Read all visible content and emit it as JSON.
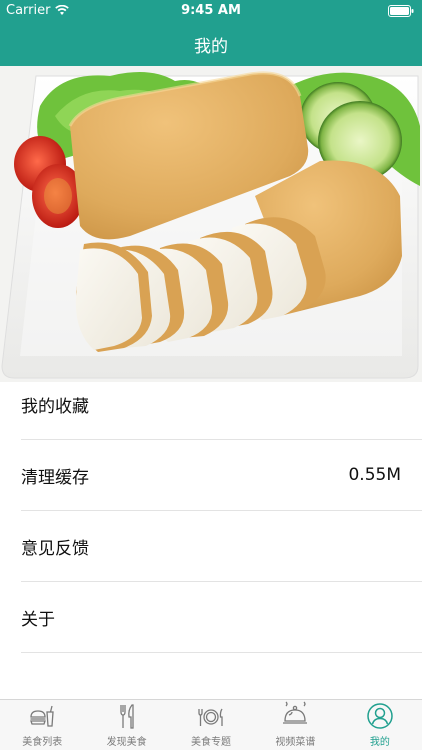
{
  "status": {
    "carrier": "Carrier",
    "time": "9:45 AM"
  },
  "nav": {
    "title": "我的"
  },
  "hero": {
    "image": "fish-cake-on-plate"
  },
  "settings": {
    "items": [
      {
        "label": "我的收藏",
        "value": ""
      },
      {
        "label": "清理缓存",
        "value": "0.55M"
      },
      {
        "label": "意见反馈",
        "value": ""
      },
      {
        "label": "关于",
        "value": ""
      }
    ]
  },
  "tabbar": {
    "tabs": [
      {
        "label": "美食列表",
        "icon": "burger-drink-icon"
      },
      {
        "label": "发现美食",
        "icon": "fork-knife-icon"
      },
      {
        "label": "美食专题",
        "icon": "plate-cutlery-icon"
      },
      {
        "label": "视频菜谱",
        "icon": "cloche-icon"
      },
      {
        "label": "我的",
        "icon": "user-circle-icon",
        "active": true
      }
    ]
  },
  "colors": {
    "accent": "#21a08f",
    "tab_inactive": "#7a7a7a",
    "divider": "#e3e3e3"
  }
}
